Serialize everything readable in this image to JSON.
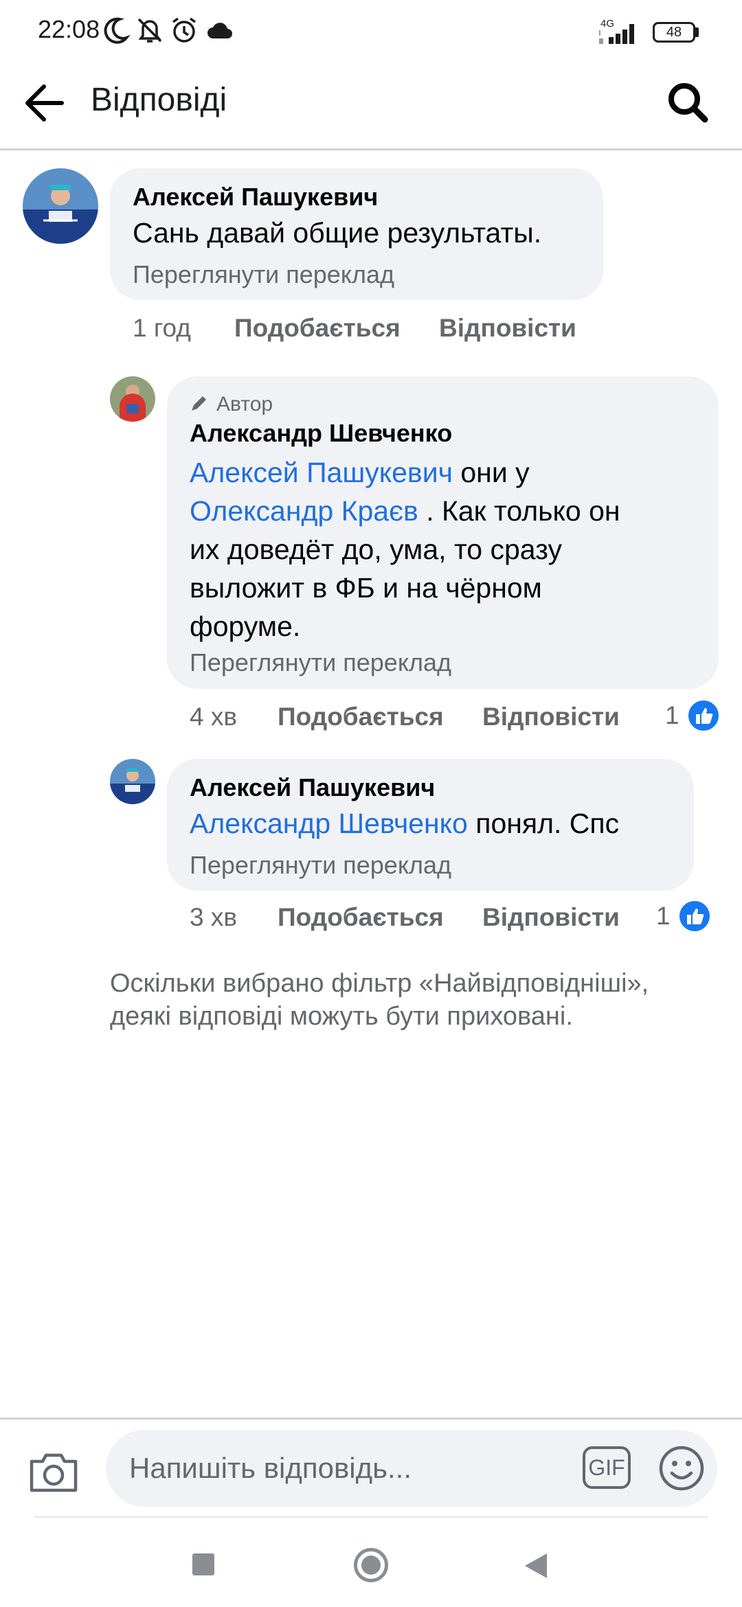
{
  "status_bar": {
    "time": "22:08",
    "network": "4G",
    "battery": "48",
    "icons": [
      "moon-icon",
      "mute-bell-icon",
      "alarm-icon",
      "cloud-icon",
      "signal-icon",
      "battery-icon"
    ]
  },
  "app_bar": {
    "title": "Відповіді",
    "back_icon": "arrow-left-icon",
    "search_icon": "search-icon"
  },
  "comments": [
    {
      "author": "Алексей Пашукевич",
      "text": "Сань давай общие результаты.",
      "translate": "Переглянути переклад",
      "time": "1 год",
      "like_label": "Подобається",
      "reply_label": "Відповісти"
    },
    {
      "badge": "Автор",
      "author": "Александр Шевченко",
      "mention_1": "Алексей Пашукевич",
      "text_1": " они у",
      "mention_2": "Олександр Краєв",
      "text_2": " . Как только он",
      "text_lines": [
        "их доведёт до, ума, то сразу",
        "выложит в ФБ и на чёрном",
        "форуме."
      ],
      "translate": "Переглянути переклад",
      "time": "4 хв",
      "like_label": "Подобається",
      "reply_label": "Відповісти",
      "likes": "1"
    },
    {
      "author": "Алексей Пашукевич",
      "mention": "Александр Шевченко",
      "text": " понял. Спс",
      "translate": "Переглянути переклад",
      "time": "3 хв",
      "like_label": "Подобається",
      "reply_label": "Відповісти",
      "likes": "1"
    }
  ],
  "filter_note": "Оскільки вибрано фільтр «Найвідповідніші», деякі відповіді можуть бути приховані.",
  "composer": {
    "placeholder": "Напишіть відповідь...",
    "gif_label": "GIF"
  },
  "colors": {
    "accent": "#1877f2",
    "mention": "#216fdb",
    "bubble": "#f0f2f5",
    "secondary_text": "#65676b"
  }
}
